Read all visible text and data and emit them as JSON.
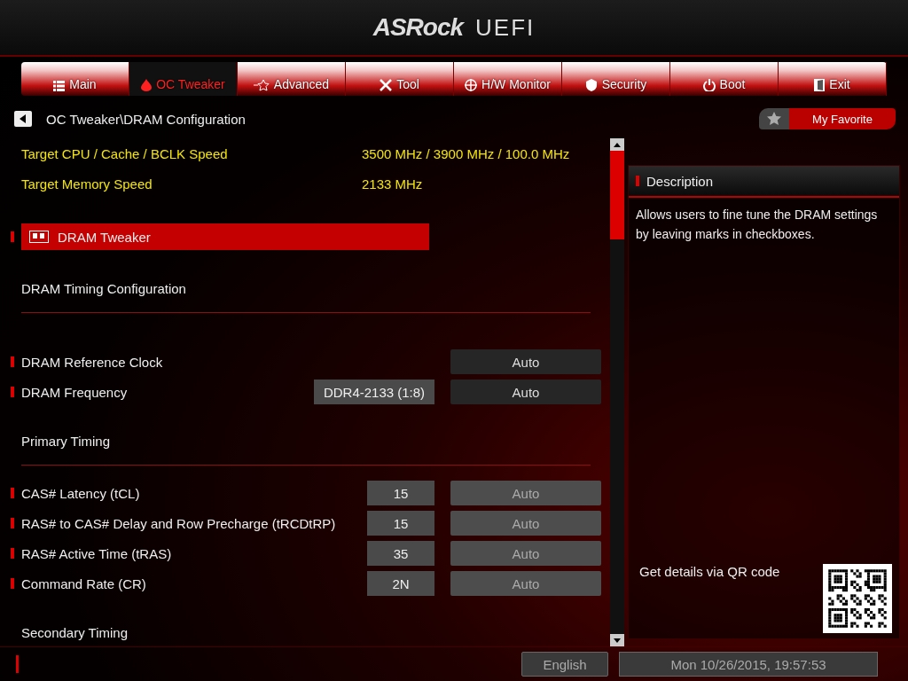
{
  "header": {
    "logo": "ASRock",
    "title": "UEFI"
  },
  "tabs": [
    {
      "label": "Main",
      "selected": false
    },
    {
      "label": "OC Tweaker",
      "selected": true
    },
    {
      "label": "Advanced",
      "selected": false
    },
    {
      "label": "Tool",
      "selected": false
    },
    {
      "label": "H/W Monitor",
      "selected": false
    },
    {
      "label": "Security",
      "selected": false
    },
    {
      "label": "Boot",
      "selected": false
    },
    {
      "label": "Exit",
      "selected": false
    }
  ],
  "breadcrumb": "OC Tweaker\\DRAM Configuration",
  "favorite": {
    "label": "My Favorite"
  },
  "items": [
    {
      "kind": "info",
      "label": "Target CPU / Cache / BCLK Speed",
      "value": "3500 MHz / 3900 MHz / 100.0 MHz"
    },
    {
      "kind": "info",
      "label": "Target Memory Speed",
      "value": "2133 MHz"
    },
    {
      "kind": "submenu",
      "label": "DRAM Tweaker",
      "selected": true
    },
    {
      "kind": "section",
      "label": "DRAM Timing Configuration"
    },
    {
      "kind": "setting",
      "label": "DRAM Reference Clock",
      "option": "Auto",
      "disabled": false
    },
    {
      "kind": "setting",
      "label": "DRAM Frequency",
      "value": "DDR4-2133 (1:8)",
      "option": "Auto",
      "disabled": false
    },
    {
      "kind": "section",
      "label": "Primary Timing"
    },
    {
      "kind": "setting",
      "label": "CAS# Latency (tCL)",
      "value": "15",
      "option": "Auto",
      "disabled": true
    },
    {
      "kind": "setting",
      "label": "RAS# to CAS# Delay and Row Precharge (tRCDtRP)",
      "value": "15",
      "option": "Auto",
      "disabled": true
    },
    {
      "kind": "setting",
      "label": "RAS# Active Time (tRAS)",
      "value": "35",
      "option": "Auto",
      "disabled": true
    },
    {
      "kind": "setting",
      "label": "Command Rate (CR)",
      "value": "2N",
      "option": "Auto",
      "disabled": true
    },
    {
      "kind": "section",
      "label": "Secondary Timing"
    }
  ],
  "description": {
    "title": "Description",
    "text": "Allows users to fine tune the DRAM settings by leaving marks in checkboxes.",
    "qr_label": "Get details via QR code"
  },
  "footer": {
    "language": "English",
    "datetime": "Mon 10/26/2015, 19:57:53"
  }
}
